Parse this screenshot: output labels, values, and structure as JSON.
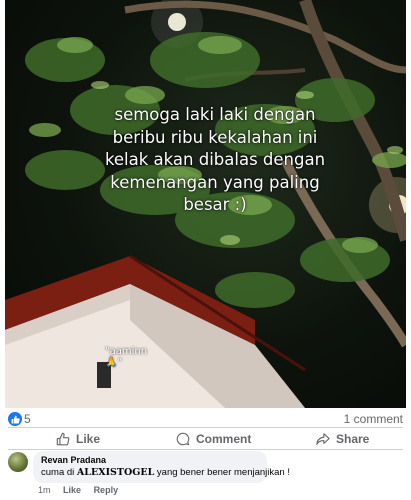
{
  "post": {
    "overlay_text": "semoga laki laki dengan\nberibu ribu kekalahan ini\nkelak akan dibalas dengan\nkemenangan yang paling\nbesar :)",
    "small_caption": "\"aaminn 🙏\""
  },
  "reactions": {
    "count": "5",
    "comments_count": "1 comment"
  },
  "actions": {
    "like": "Like",
    "comment": "Comment",
    "share": "Share"
  },
  "comment": {
    "author": "Revan Pradana",
    "text_before": "cuma di ",
    "text_bold": "ALEXISTOGEL",
    "text_after": " yang bener bener menjanjikan !",
    "time": "1m",
    "like": "Like",
    "reply": "Reply"
  },
  "colors": {
    "accent": "#1877f2",
    "muted_text": "#65676b",
    "bubble": "#f0f2f5"
  }
}
